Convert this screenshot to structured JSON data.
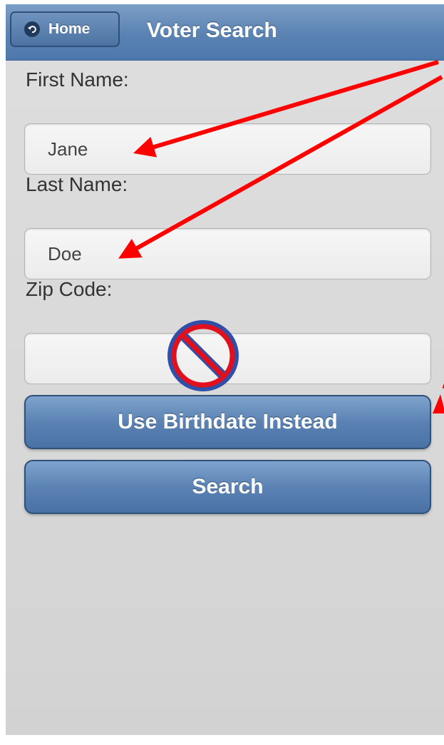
{
  "header": {
    "home_label": "Home",
    "title": "Voter Search"
  },
  "form": {
    "first_name_label": "First Name:",
    "first_name_value": "Jane",
    "last_name_label": "Last Name:",
    "last_name_value": "Doe",
    "zip_label": "Zip Code:",
    "zip_value": ""
  },
  "buttons": {
    "birthdate_label": "Use Birthdate Instead",
    "search_label": "Search"
  },
  "colors": {
    "header": "#5a83b3",
    "button": "#5b82b3",
    "annotation_arrow": "#ff0000",
    "prohibition_ring": "#e0101e",
    "prohibition_fill": "#2f4fa8"
  },
  "icons": [
    "back-arrow-icon",
    "prohibition-icon",
    "annotation-arrow"
  ]
}
